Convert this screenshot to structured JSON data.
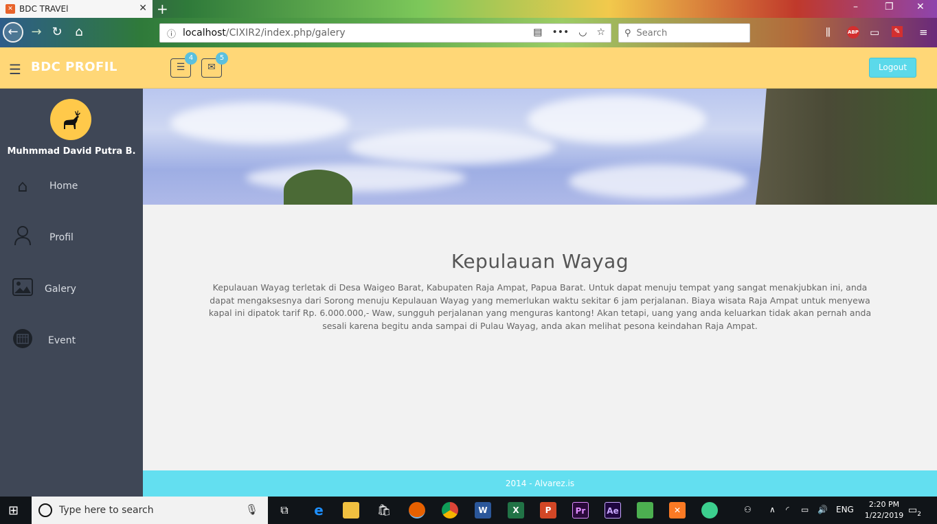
{
  "browser": {
    "tab_title": "BDC TRAVEl",
    "tab_favicon": "xampp-icon",
    "url_host": "localhost",
    "url_path": "/CIXIR2/index.php/galery",
    "search_placeholder": "Search",
    "abp_label": "ABP"
  },
  "header": {
    "brand": "BDC PROFIL",
    "tasks_badge": "4",
    "messages_badge": "5",
    "logout_label": "Logout"
  },
  "sidebar": {
    "username": "Muhmmad David Putra B.",
    "items": [
      {
        "label": "Home",
        "icon": "home-icon"
      },
      {
        "label": "Profil",
        "icon": "user-icon"
      },
      {
        "label": "Galery",
        "icon": "image-icon"
      },
      {
        "label": "Event",
        "icon": "calendar-icon"
      }
    ]
  },
  "main": {
    "title": "Kepulauan Wayag",
    "description": "Kepulauan Wayag terletak di Desa Waigeo Barat, Kabupaten Raja Ampat, Papua Barat. Untuk dapat menuju tempat yang sangat menakjubkan ini, anda dapat mengaksesnya dari Sorong menuju Kepulauan Wayag yang memerlukan waktu sekitar 6 jam perjalanan. Biaya wisata Raja Ampat untuk menyewa kapal ini dipatok tarif Rp. 6.000.000,- Waw, sungguh perjalanan yang menguras kantong! Akan tetapi, uang yang anda keluarkan tidak akan pernah anda sesali karena begitu anda sampai di Pulau Wayag, anda akan melihat pesona keindahan Raja Ampat."
  },
  "footer": {
    "text": "2014 - Alvarez.is"
  },
  "taskbar": {
    "search_placeholder": "Type here to search",
    "language": "ENG",
    "time": "2:20 PM",
    "date": "1/22/2019",
    "notification_count": "2",
    "apps": [
      {
        "name": "word-icon",
        "label": "W",
        "color": "#2b579a"
      },
      {
        "name": "excel-icon",
        "label": "X",
        "color": "#217346"
      },
      {
        "name": "powerpoint-icon",
        "label": "P",
        "color": "#d24726"
      },
      {
        "name": "premiere-icon",
        "label": "Pr",
        "color": "#2a0a3a"
      },
      {
        "name": "aftereffects-icon",
        "label": "Ae",
        "color": "#1f0740"
      }
    ]
  },
  "colors": {
    "header_bg": "#ffd777",
    "sidebar_bg": "#3f4756",
    "footer_bg": "#63dff0",
    "logout_bg": "#5bd9ea",
    "badge_bg": "#5bc0de"
  }
}
